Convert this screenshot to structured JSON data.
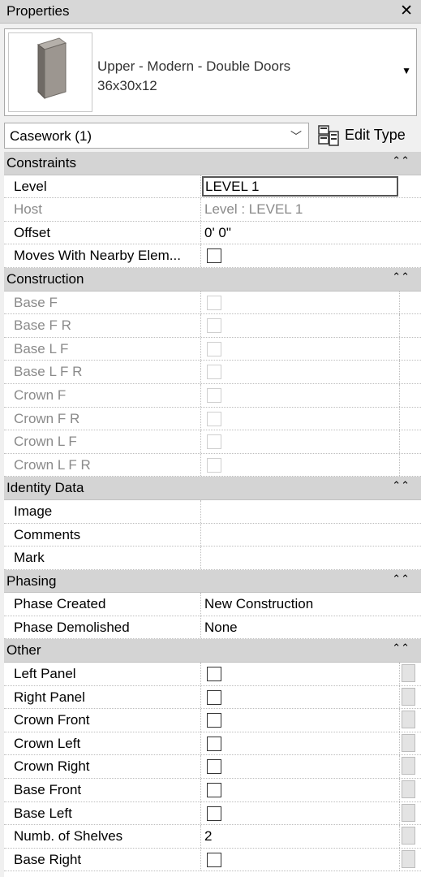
{
  "panel": {
    "title": "Properties",
    "close_glyph": "✕"
  },
  "type_selector": {
    "line1": "Upper - Modern - Double Doors",
    "line2": "36x30x12",
    "thumbnail_icon": "cabinet-thumbnail-icon",
    "dropdown_glyph": "▼"
  },
  "instance_filter": {
    "value": "Casework (1)",
    "chevron": "﹀"
  },
  "edit_type": {
    "label": "Edit Type",
    "icon": "edit-type-icon"
  },
  "groups": {
    "constraints": {
      "label": "Constraints",
      "collapse": "⌃⌃"
    },
    "construction": {
      "label": "Construction",
      "collapse": "⌃⌃"
    },
    "identity": {
      "label": "Identity Data",
      "collapse": "⌃⌃"
    },
    "phasing": {
      "label": "Phasing",
      "collapse": "⌃⌃"
    },
    "other": {
      "label": "Other",
      "collapse": "⌃⌃"
    }
  },
  "constraints": {
    "level": {
      "name": "Level",
      "value": "LEVEL 1"
    },
    "host": {
      "name": "Host",
      "value": "Level : LEVEL 1"
    },
    "offset": {
      "name": "Offset",
      "value": "0'  0\""
    },
    "moves": {
      "name": "Moves With Nearby Elem...",
      "checked": false
    }
  },
  "construction": [
    {
      "name": "Base F"
    },
    {
      "name": "Base F R"
    },
    {
      "name": "Base L F"
    },
    {
      "name": "Base L F R"
    },
    {
      "name": "Crown F"
    },
    {
      "name": "Crown F R"
    },
    {
      "name": "Crown L F"
    },
    {
      "name": "Crown L F R"
    }
  ],
  "identity": [
    {
      "name": "Image",
      "value": ""
    },
    {
      "name": "Comments",
      "value": ""
    },
    {
      "name": "Mark",
      "value": ""
    }
  ],
  "phasing": {
    "created": {
      "name": "Phase Created",
      "value": "New Construction"
    },
    "demolished": {
      "name": "Phase Demolished",
      "value": "None"
    }
  },
  "other": [
    {
      "name": "Left Panel"
    },
    {
      "name": "Right Panel"
    },
    {
      "name": "Crown Front"
    },
    {
      "name": "Crown Left"
    },
    {
      "name": "Crown Right"
    },
    {
      "name": "Base Front"
    },
    {
      "name": "Base Left"
    },
    {
      "name": "Numb. of Shelves",
      "value": "2"
    },
    {
      "name": "Base Right"
    }
  ],
  "colors": {
    "group_header_bg": "#d4d4d4",
    "disabled_text": "#8a8a8a",
    "panel_bg": "#f0f0f0"
  }
}
